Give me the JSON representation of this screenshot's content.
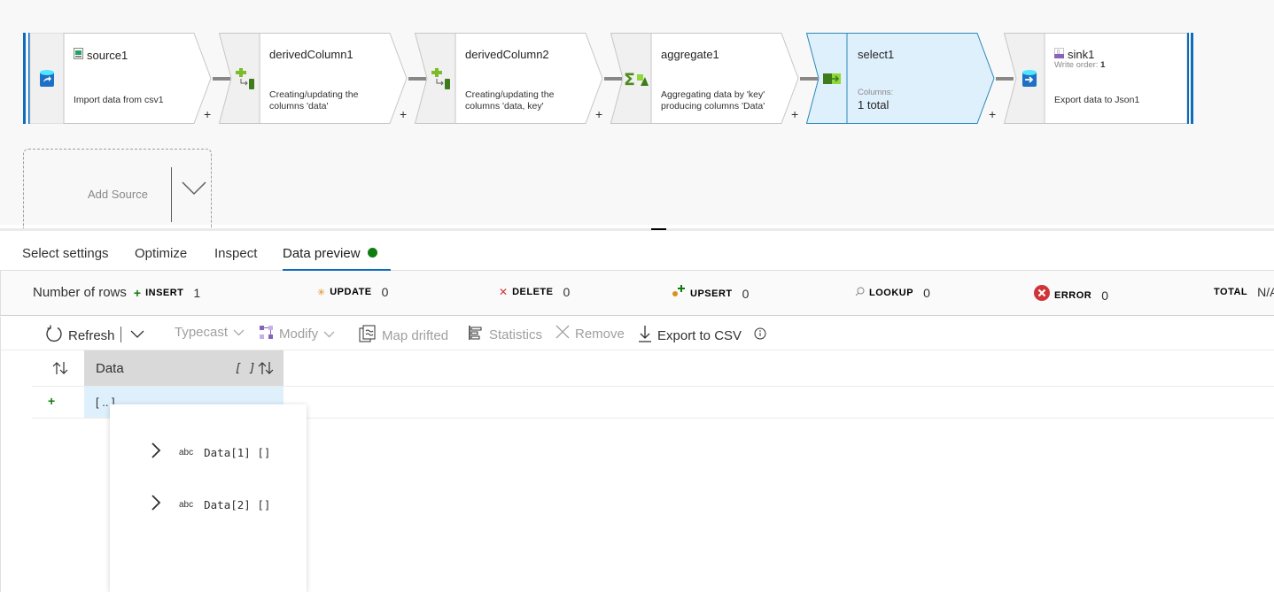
{
  "pipeline": {
    "nodes": [
      {
        "id": "source1",
        "title": "source1",
        "description": "Import data from csv1",
        "icon": "database-import-icon",
        "title_icon": "csv-file-icon"
      },
      {
        "id": "derivedColumn1",
        "title": "derivedColumn1",
        "description_line1": "Creating/updating the",
        "description_line2": "columns 'data'",
        "icon": "derived-column-icon"
      },
      {
        "id": "derivedColumn2",
        "title": "derivedColumn2",
        "description_line1": "Creating/updating the",
        "description_line2": "columns 'data, key'",
        "icon": "derived-column-icon"
      },
      {
        "id": "aggregate1",
        "title": "aggregate1",
        "description_line1": "Aggregating data by 'key'",
        "description_line2": "producing columns 'Data'",
        "icon": "aggregate-sigma-icon"
      },
      {
        "id": "select1",
        "title": "select1",
        "columns_label": "Columns:",
        "columns_value": "1 total",
        "icon": "select-icon",
        "selected": true
      },
      {
        "id": "sink1",
        "title": "sink1",
        "write_order_label": "Write order:",
        "write_order_value": "1",
        "description": "Export data to Json1",
        "icon": "database-export-icon",
        "title_icon": "json-file-icon"
      }
    ],
    "add_node_symbol": "+",
    "add_source_label": "Add Source"
  },
  "tabs": [
    {
      "label": "Select settings",
      "active": false
    },
    {
      "label": "Optimize",
      "active": false
    },
    {
      "label": "Inspect",
      "active": false
    },
    {
      "label": "Data preview",
      "active": true,
      "status": "ready"
    }
  ],
  "stats": {
    "rows_label": "Number of rows",
    "insert": {
      "label": "INSERT",
      "value": "1"
    },
    "update": {
      "label": "UPDATE",
      "value": "0"
    },
    "delete": {
      "label": "DELETE",
      "value": "0"
    },
    "upsert": {
      "label": "UPSERT",
      "value": "0"
    },
    "lookup": {
      "label": "LOOKUP",
      "value": "0"
    },
    "error": {
      "label": "ERROR",
      "value": "0"
    },
    "total": {
      "label": "TOTAL",
      "value": "N/A"
    }
  },
  "toolbar": {
    "refresh": "Refresh",
    "typecast": "Typecast",
    "modify": "Modify",
    "map_drifted": "Map drifted",
    "statistics": "Statistics",
    "remove": "Remove",
    "export_csv": "Export to CSV"
  },
  "grid": {
    "columns": [
      {
        "name": "Data",
        "type_badge": "[ ]"
      }
    ],
    "rows": [
      {
        "marker": "+",
        "values": [
          "[ .. ]"
        ]
      }
    ]
  },
  "popup": {
    "items": [
      {
        "type": "abc",
        "name": "Data[1] []"
      },
      {
        "type": "abc",
        "name": "Data[2] []"
      }
    ]
  },
  "colors": {
    "accent": "#0f6cbd",
    "selected_node_fill": "#dff0fd",
    "selected_node_border": "#2b88b8",
    "insert": "#107c10",
    "update": "#d99020",
    "delete": "#d13438",
    "error": "#d13438"
  }
}
